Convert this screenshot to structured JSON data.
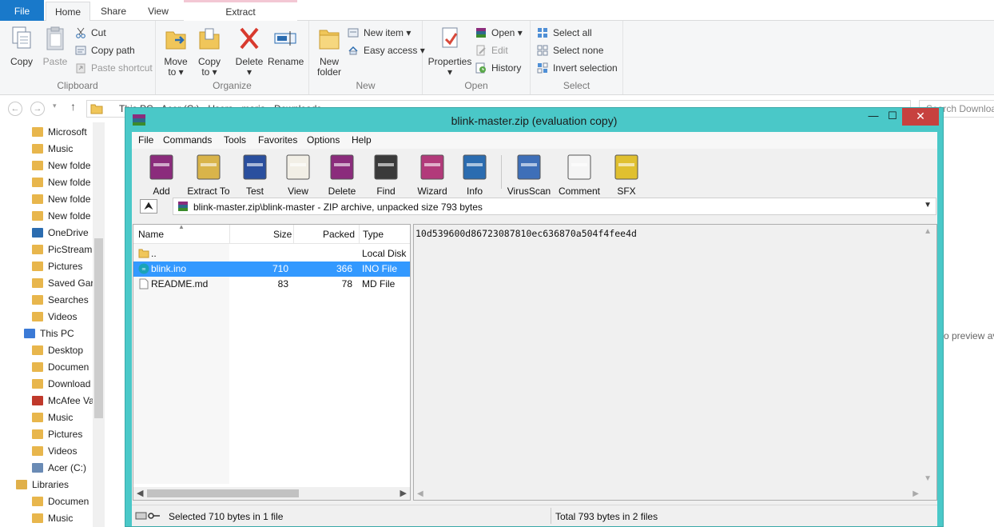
{
  "explorer": {
    "tabs": [
      "File",
      "Home",
      "Share",
      "View",
      "Extract"
    ],
    "clipboard": {
      "group_label": "Clipboard",
      "copy": "Copy",
      "paste": "Paste",
      "cut": "Cut",
      "copy_path": "Copy path",
      "paste_shortcut": "Paste shortcut"
    },
    "organize": {
      "group_label": "Organize",
      "move_to": "Move",
      "move_to_2": "to",
      "copy_to": "Copy",
      "copy_to_2": "to",
      "delete": "Delete",
      "rename": "Rename"
    },
    "new": {
      "group_label": "New",
      "new_folder": "New",
      "new_folder_2": "folder",
      "new_item": "New item",
      "easy_access": "Easy access"
    },
    "open": {
      "group_label": "Open",
      "properties": "Properties",
      "open": "Open",
      "edit": "Edit",
      "history": "History"
    },
    "select": {
      "group_label": "Select",
      "select_all": "Select all",
      "select_none": "Select none",
      "invert_selection": "Invert selection"
    },
    "address": "This PC  ›  Acer (C:)  ›  Users  ›  maria  ›  Downloads",
    "search_placeholder": "Search Download",
    "preview_text": "o preview av",
    "nav_items": [
      "Microsoft",
      "Music",
      "New folde",
      "New folde",
      "New folde",
      "New folde",
      "OneDrive",
      "PicStream",
      "Pictures",
      "Saved Gar",
      "Searches",
      "Videos",
      "This PC",
      "Desktop",
      "Documen",
      "Download",
      "McAfee Va",
      "Music",
      "Pictures",
      "Videos",
      "Acer (C:)",
      "Libraries",
      "Documen",
      "Music"
    ]
  },
  "winrar": {
    "title": "blink-master.zip (evaluation copy)",
    "window_buttons": {
      "minimize": "—",
      "maximize": "☐",
      "close": "✕"
    },
    "menu": [
      "File",
      "Commands",
      "Tools",
      "Favorites",
      "Options",
      "Help"
    ],
    "toolbar": [
      "Add",
      "Extract To",
      "Test",
      "View",
      "Delete",
      "Find",
      "Wizard",
      "Info",
      "VirusScan",
      "Comment",
      "SFX"
    ],
    "path": "blink-master.zip\\blink-master - ZIP archive, unpacked size 793 bytes",
    "columns": {
      "name": "Name",
      "size": "Size",
      "packed": "Packed",
      "type": "Type"
    },
    "files": [
      {
        "name": "..",
        "size": "",
        "packed": "",
        "type": "Local Disk"
      },
      {
        "name": "blink.ino",
        "size": "710",
        "packed": "366",
        "type": "INO File"
      },
      {
        "name": "README.md",
        "size": "83",
        "packed": "78",
        "type": "MD File"
      }
    ],
    "info_hash": "10d539600d86723087810ec636870a504f4fee4d",
    "status_left": "Selected 710 bytes in 1 file",
    "status_right": "Total 793 bytes in 2 files"
  }
}
